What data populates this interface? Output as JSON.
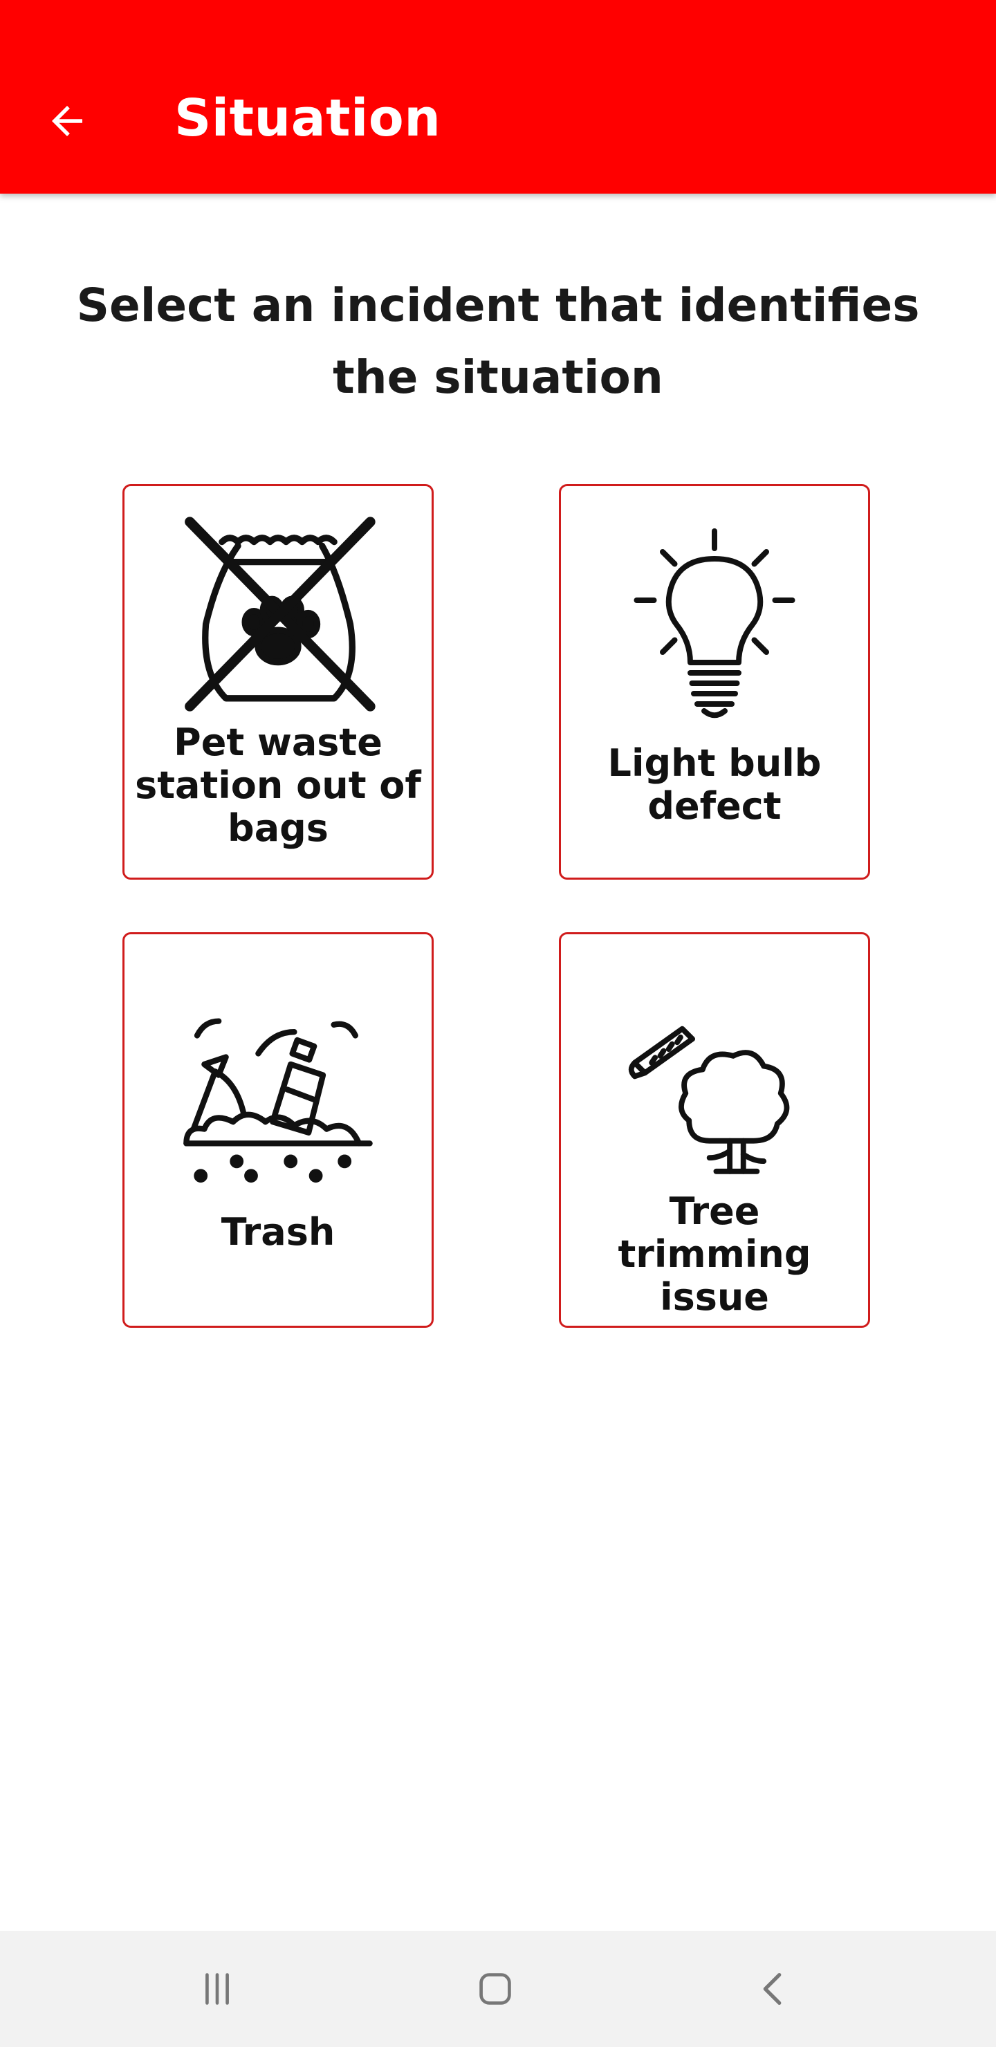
{
  "app_bar": {
    "title": "Situation",
    "back_icon": "arrow-left-icon",
    "background_color": "#ff0000"
  },
  "prompt": "Select an incident that identifies the situation",
  "tile_border_color": "#d01c1c",
  "incidents": [
    {
      "label": "Pet waste station out of bags",
      "icon": "pet-waste-bag-crossed-icon"
    },
    {
      "label": "Light bulb defect",
      "icon": "light-bulb-icon"
    },
    {
      "label": "Trash",
      "icon": "trash-pile-icon"
    },
    {
      "label": "Tree trimming issue",
      "icon": "tree-saw-icon"
    }
  ],
  "nav_bar": {
    "recents_icon": "recent-apps-icon",
    "home_icon": "home-icon",
    "back_icon": "back-chevron-icon"
  }
}
